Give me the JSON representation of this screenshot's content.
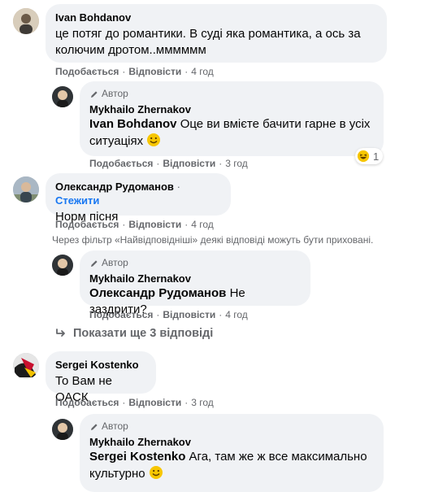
{
  "labels": {
    "like": "Подобається",
    "reply": "Відповісти",
    "dot": "·",
    "author": "Автор",
    "follow": "Стежити"
  },
  "comments": [
    {
      "author": "Ivan Bohdanov",
      "text": "це потяг до романтики. В суді яка романтика, а ось за колючим дротом..мммммм",
      "time": "4 год"
    },
    {
      "author": "Mykhailo Zhernakov",
      "mention": "Ivan Bohdanov",
      "text": "Оце ви вмієте бачити гарне в усіх ситуаціях",
      "time": "3 год",
      "reaction_count": "1"
    },
    {
      "author": "Олександр Рудоманов",
      "text": "Норм пісня",
      "time": "4 год"
    },
    {
      "author": "Mykhailo Zhernakov",
      "mention": "Олександр Рудоманов",
      "text": "Не заздрити?",
      "time": "4 год"
    },
    {
      "author": "Sergei Kostenko",
      "text": "То Вам не ОАСК",
      "time": "3 год"
    },
    {
      "author": "Mykhailo Zhernakov",
      "mention": "Sergei Kostenko",
      "text": "Ага, там же ж все максимально культурно",
      "time": ""
    }
  ],
  "filter_note": "Через фільтр «Найвідповідніші» деякі відповіді можуть бути приховані.",
  "more_replies": "Показати ще 3 відповіді",
  "colors": {
    "bubble": "#f0f2f5",
    "secondary_text": "#65676b",
    "link_blue": "#1877f2"
  }
}
